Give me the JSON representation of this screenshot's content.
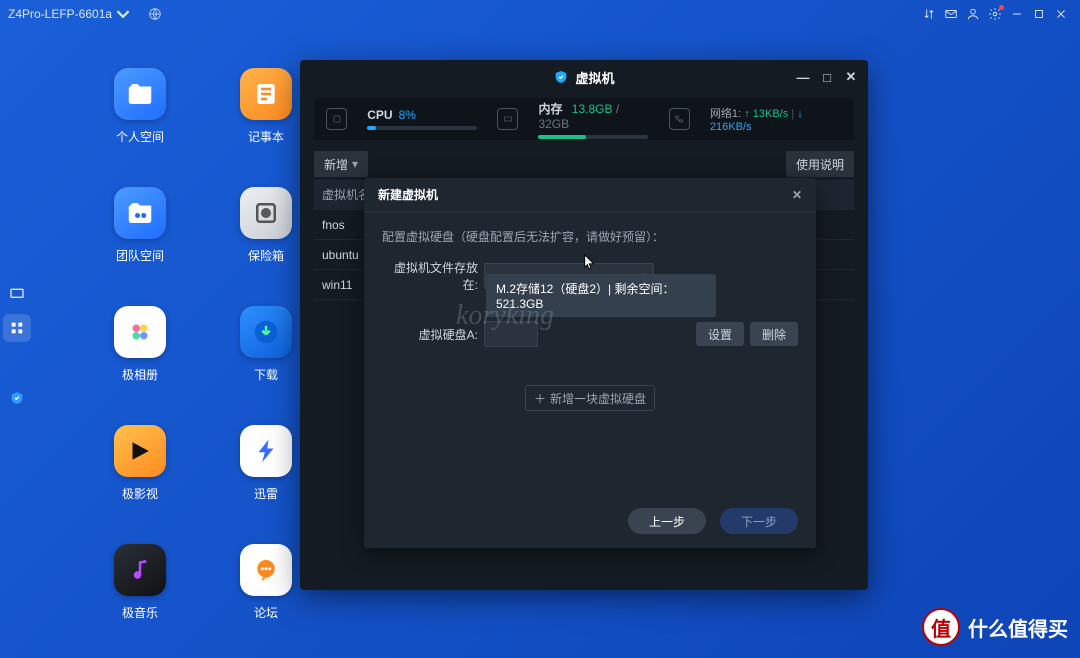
{
  "topbar": {
    "device_name": "Z4Pro-LEFP-6601a"
  },
  "desktop_icons": [
    {
      "id": "personal-space",
      "label": "个人空间"
    },
    {
      "id": "notepad",
      "label": "记事本"
    },
    {
      "id": "team-space",
      "label": "团队空间"
    },
    {
      "id": "safe-box",
      "label": "保险箱"
    },
    {
      "id": "photo-album",
      "label": "极相册"
    },
    {
      "id": "downloads",
      "label": "下载"
    },
    {
      "id": "video",
      "label": "极影视"
    },
    {
      "id": "xunlei",
      "label": "迅雷"
    },
    {
      "id": "music",
      "label": "极音乐"
    },
    {
      "id": "forum",
      "label": "论坛"
    }
  ],
  "vm_window": {
    "title": "虚拟机",
    "stats": {
      "cpu_label": "CPU",
      "cpu_pct": "8%",
      "mem_label": "内存",
      "mem_used": "13.8GB",
      "mem_total": "32GB",
      "net_label": "网络1:",
      "net_up": "13KB/s",
      "net_down": "216KB/s"
    },
    "toolbar": {
      "add": "新增",
      "help": "使用说明"
    },
    "table": {
      "col_name": "虚拟机名称",
      "rows": [
        "fnos",
        "ubuntu",
        "win11"
      ]
    }
  },
  "modal": {
    "title": "新建虚拟机",
    "hint": "配置虚拟硬盘（硬盘配置后无法扩容，请做好预留）：",
    "field_location": "虚拟机文件存放在:",
    "field_diskA": "虚拟硬盘A:",
    "dropdown_option": "M.2存储12（硬盘2）| 剩余空间：521.3GB",
    "btn_settings": "设置",
    "btn_delete": "删除",
    "btn_add_disk": "新增一块虚拟硬盘",
    "btn_prev": "上一步",
    "btn_next": "下一步"
  },
  "watermark": "koryking",
  "badge": {
    "char": "值",
    "text": "什么值得买"
  }
}
